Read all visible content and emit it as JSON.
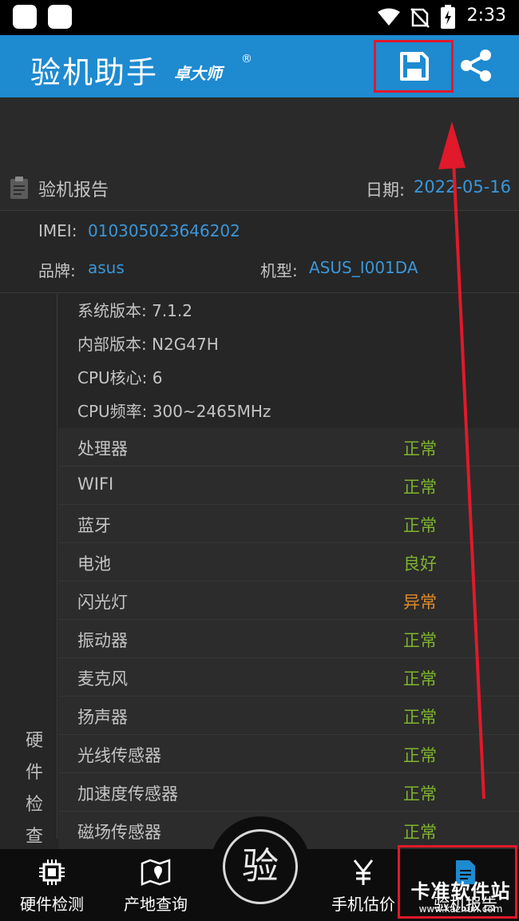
{
  "status_bar": {
    "time": "2:33"
  },
  "app_bar": {
    "title": "验机助手",
    "subtitle": "卓大师",
    "reg_mark": "®",
    "save_icon": "floppy-disk-icon",
    "share_icon": "share-icon"
  },
  "report": {
    "title": "验机报告",
    "date_label": "日期:",
    "date": "2022-05-16",
    "imei_label": "IMEI:",
    "imei": "010305023646202",
    "brand_label": "品牌:",
    "brand": "asus",
    "model_label": "机型:",
    "model": "ASUS_I001DA"
  },
  "system": [
    "系统版本: 7.1.2",
    "内部版本: N2G47H",
    "CPU核心: 6",
    "CPU频率: 300~2465MHz"
  ],
  "side_label": "硬件检查",
  "checks": [
    {
      "name": "处理器",
      "status": "正常",
      "color": "#7fb32e"
    },
    {
      "name": "WIFI",
      "status": "正常",
      "color": "#7fb32e"
    },
    {
      "name": "蓝牙",
      "status": "正常",
      "color": "#7fb32e"
    },
    {
      "name": "电池",
      "status": "良好",
      "color": "#7fb32e"
    },
    {
      "name": "闪光灯",
      "status": "异常",
      "color": "#e08a2a"
    },
    {
      "name": "振动器",
      "status": "正常",
      "color": "#7fb32e"
    },
    {
      "name": "麦克风",
      "status": "正常",
      "color": "#7fb32e"
    },
    {
      "name": "扬声器",
      "status": "正常",
      "color": "#7fb32e"
    },
    {
      "name": "光线传感器",
      "status": "正常",
      "color": "#7fb32e"
    },
    {
      "name": "加速度传感器",
      "status": "正常",
      "color": "#7fb32e"
    },
    {
      "name": "磁场传感器",
      "status": "正常",
      "color": "#7fb32e"
    }
  ],
  "bottom_nav": {
    "hardware": "硬件检测",
    "origin": "产地查询",
    "center": "验",
    "price": "手机估价",
    "report": "验机报告"
  },
  "watermark": {
    "main": "卡准软件站",
    "url": "www.kazhun.com"
  },
  "colors": {
    "accent": "#1e8ad0",
    "highlight": "#e0192b",
    "ok": "#7fb32e",
    "warn": "#e08a2a",
    "link": "#3a97da"
  }
}
